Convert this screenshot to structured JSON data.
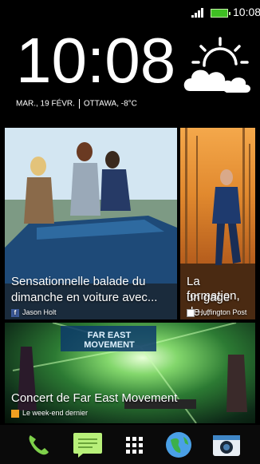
{
  "status_bar": {
    "time": "10:08",
    "signal_icon": "signal-bars-icon",
    "battery_icon": "battery-icon",
    "battery_color": "#3fbf23"
  },
  "clock_widget": {
    "time": "10:08",
    "date": "MAR., 19 FÉVR.",
    "location_temp": "OTTAWA, -8°C",
    "weather_icon": "partly-cloudy-icon"
  },
  "feed": {
    "tiles": [
      {
        "title_line1": "Sensationnelle balade du",
        "title_line2": "dimanche en voiture avec...",
        "source": "Jason Holt",
        "source_icon": "facebook-icon"
      },
      {
        "title_line1": "La formation,",
        "title_line2": "un gage de...",
        "source": "Huffington Post",
        "source_icon": "news-icon"
      },
      {
        "title_line1": "Concert de Far East Movement",
        "source": "Le week-end dernier",
        "source_icon": "gallery-icon",
        "banner_text": "FAR EAST MOVEMENT"
      }
    ]
  },
  "dock": {
    "items": [
      {
        "icon": "phone-icon"
      },
      {
        "icon": "messages-icon"
      },
      {
        "icon": "app-drawer-icon"
      },
      {
        "icon": "browser-globe-icon"
      },
      {
        "icon": "camera-icon"
      }
    ]
  }
}
